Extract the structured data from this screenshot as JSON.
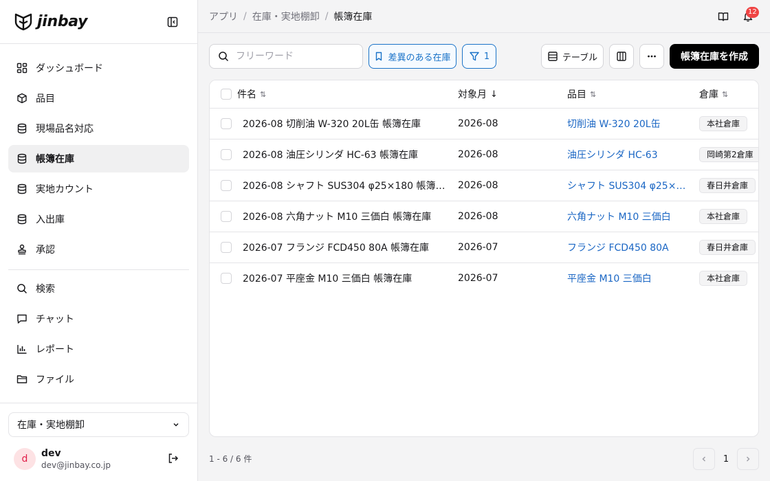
{
  "brand": {
    "name": "jinbay"
  },
  "sidebar": {
    "nav_primary": [
      {
        "label": "ダッシュボード",
        "icon": "dashboard-icon"
      },
      {
        "label": "品目",
        "icon": "package-icon"
      },
      {
        "label": "現場品名対応",
        "icon": "database-icon"
      },
      {
        "label": "帳簿在庫",
        "icon": "database-icon",
        "active": true
      },
      {
        "label": "実地カウント",
        "icon": "database-icon"
      },
      {
        "label": "入出庫",
        "icon": "database-icon"
      },
      {
        "label": "承認",
        "icon": "stamp-icon"
      }
    ],
    "nav_secondary": [
      {
        "label": "検索",
        "icon": "search-icon"
      },
      {
        "label": "チャット",
        "icon": "chat-icon"
      },
      {
        "label": "レポート",
        "icon": "chart-icon"
      },
      {
        "label": "ファイル",
        "icon": "folder-icon"
      }
    ],
    "app_select": "在庫・実地棚卸",
    "user": {
      "initial": "d",
      "name": "dev",
      "email": "dev@jinbay.co.jp"
    }
  },
  "breadcrumb": [
    "アプリ",
    "在庫・実地棚卸",
    "帳簿在庫"
  ],
  "notifications": {
    "count": "12"
  },
  "toolbar": {
    "search_placeholder": "フリーワード",
    "saved_filter_label": "差異のある在庫",
    "filter_count": "1",
    "view_label": "テーブル",
    "create_label": "帳簿在庫を作成"
  },
  "table": {
    "columns": [
      {
        "label": "件名",
        "sort": "⇅"
      },
      {
        "label": "対象月",
        "sort": "↓"
      },
      {
        "label": "品目",
        "sort": "⇅"
      },
      {
        "label": "倉庫",
        "sort": "⇅"
      }
    ],
    "rows": [
      {
        "name": "2026-08 切削油 W-320 20L缶 帳簿在庫",
        "month": "2026-08",
        "item": "切削油 W-320 20L缶",
        "warehouse": "本社倉庫"
      },
      {
        "name": "2026-08 油圧シリンダ HC-63 帳簿在庫",
        "month": "2026-08",
        "item": "油圧シリンダ HC-63",
        "warehouse": "岡崎第2倉庫"
      },
      {
        "name": "2026-08 シャフト SUS304 φ25×180 帳簿…",
        "month": "2026-08",
        "item": "シャフト SUS304 φ25×…",
        "warehouse": "春日井倉庫"
      },
      {
        "name": "2026-08 六角ナット M10 三価白 帳簿在庫",
        "month": "2026-08",
        "item": "六角ナット M10 三価白",
        "warehouse": "本社倉庫"
      },
      {
        "name": "2026-07 フランジ FCD450 80A 帳簿在庫",
        "month": "2026-07",
        "item": "フランジ FCD450 80A",
        "warehouse": "春日井倉庫"
      },
      {
        "name": "2026-07 平座金 M10 三価白 帳簿在庫",
        "month": "2026-07",
        "item": "平座金 M10 三価白",
        "warehouse": "本社倉庫"
      }
    ]
  },
  "footer": {
    "count_text": "1 - 6 / 6 件",
    "page": "1"
  }
}
